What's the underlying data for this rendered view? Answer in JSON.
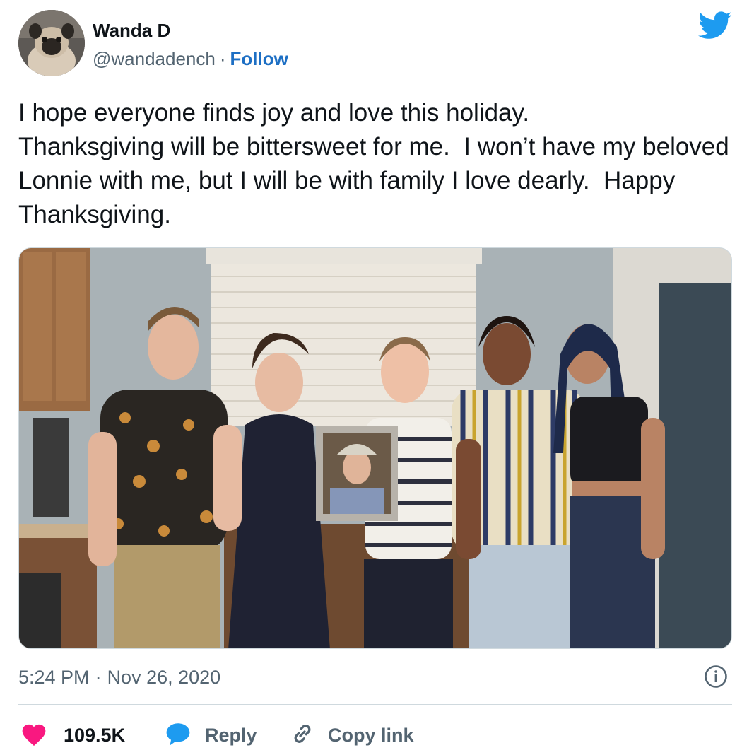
{
  "tweet": {
    "author_name": "Wanda D",
    "handle": "@wandadench",
    "separator": "·",
    "follow_label": "Follow",
    "text": "I hope everyone finds joy and love this holiday.\nThanksgiving will be bittersweet for me.  I won’t have my beloved Lonnie with me, but I will be with family I love dearly.  Happy Thanksgiving.",
    "time": "5:24 PM",
    "date": "Nov 26, 2020",
    "like_count": "109.5K",
    "reply_label": "Reply",
    "copy_link_label": "Copy link"
  },
  "icons": {
    "brand": "twitter-bird-icon",
    "info": "info-icon",
    "like": "heart-icon",
    "reply": "speech-bubble-icon",
    "copy": "link-icon"
  },
  "colors": {
    "brand_blue": "#1d9bf0",
    "follow_blue": "#1d6fc4",
    "like_pink": "#f91880",
    "secondary_text": "#536471",
    "primary_text": "#0f1419"
  }
}
